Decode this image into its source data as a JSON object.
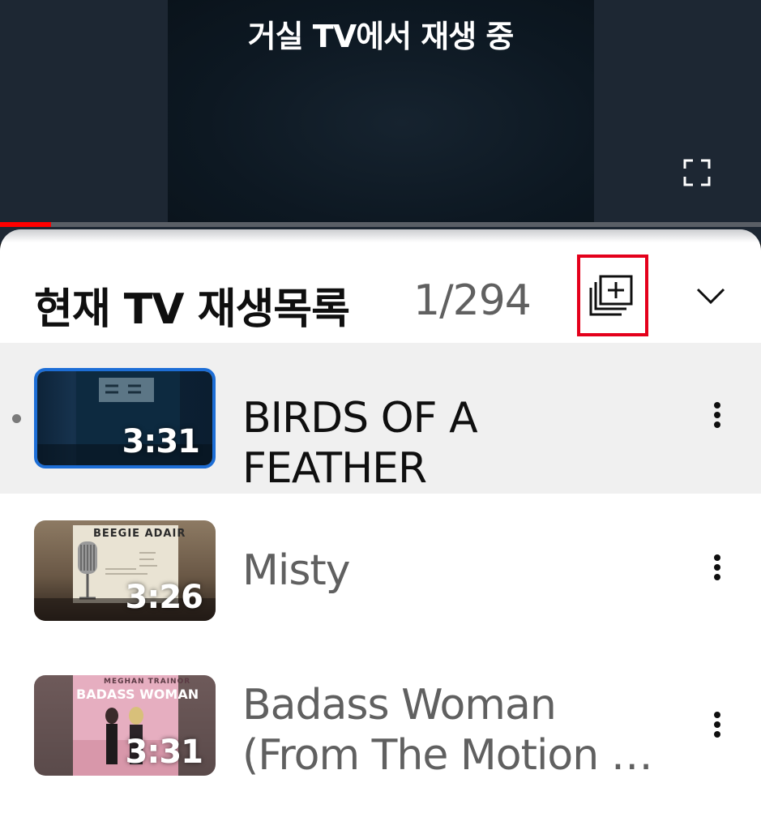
{
  "player": {
    "cast_status": "거실 TV에서 재생 중",
    "progress_fraction": 0.067
  },
  "queue": {
    "title": "현재 TV 재생목록",
    "position": "1/294",
    "items": [
      {
        "title": "BIRDS OF A FEATHER",
        "duration": "3:31",
        "now_playing": true
      },
      {
        "title": "Misty",
        "duration": "3:26",
        "now_playing": false
      },
      {
        "title": "Badass Woman (From The Motion …",
        "duration": "3:31",
        "now_playing": false
      }
    ]
  },
  "thumbnail_text": {
    "misty_artist": "BEEGIE ADAIR",
    "badass_artist": "MEGHAN TRAINOR",
    "badass_title": "BADASS WOMAN"
  },
  "colors": {
    "accent_red": "#ff0000",
    "highlight_border": "#e4001b",
    "selected_thumb_border": "#1d6ed6"
  },
  "icons": {
    "fullscreen": "fullscreen-icon",
    "save_playlist": "add-to-library-icon",
    "collapse": "chevron-down-icon",
    "more": "more-vertical-icon"
  }
}
